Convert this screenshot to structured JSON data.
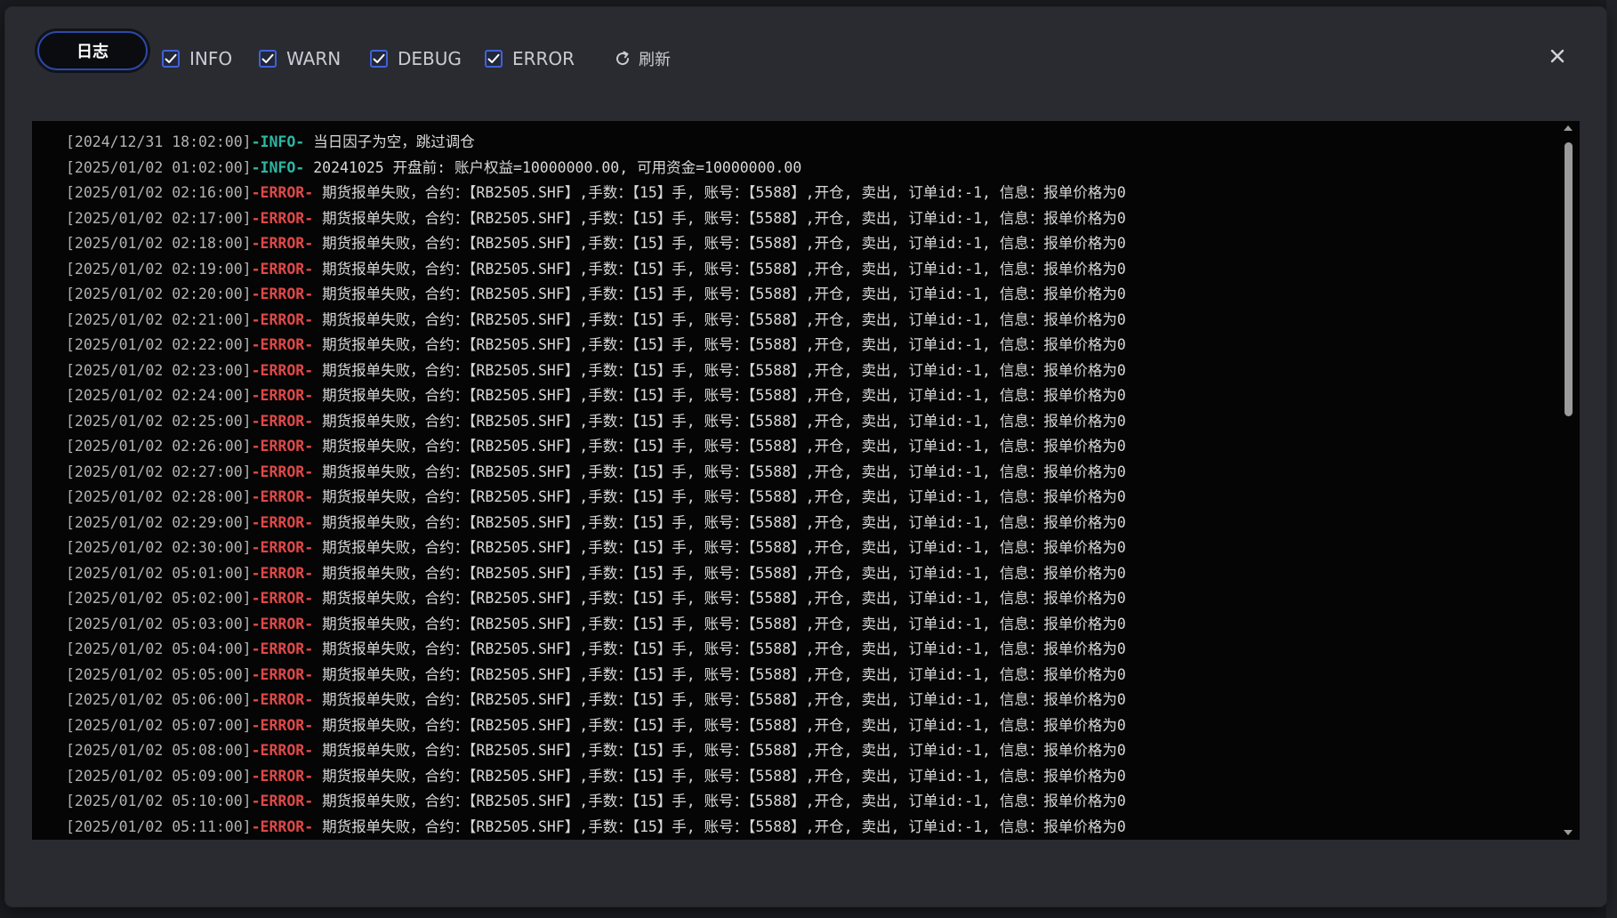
{
  "toolbar": {
    "log_tab_label": "日志",
    "filters": [
      {
        "label": "INFO",
        "checked": true
      },
      {
        "label": "WARN",
        "checked": true
      },
      {
        "label": "DEBUG",
        "checked": true
      },
      {
        "label": "ERROR",
        "checked": true
      }
    ],
    "refresh_label": "刷新",
    "close_icon": "close-icon"
  },
  "colors": {
    "accent": "#3f63d6",
    "info_level": "#2bb8a4",
    "error_level": "#e04848"
  },
  "logs": [
    {
      "ts": "[2024/12/31 18:02:00]",
      "level": "-INFO-",
      "msg": "当日因子为空，跳过调仓"
    },
    {
      "ts": "[2025/01/02 01:02:00]",
      "level": "-INFO-",
      "msg": "20241025 开盘前: 账户权益=10000000.00, 可用资金=10000000.00"
    },
    {
      "ts": "[2025/01/02 02:16:00]",
      "level": "-ERROR-",
      "msg": "期货报单失败，合约：【RB2505.SHF】,手数：【15】手, 账号：【5588】,开仓, 卖出, 订单id:-1, 信息：报单价格为0"
    },
    {
      "ts": "[2025/01/02 02:17:00]",
      "level": "-ERROR-",
      "msg": "期货报单失败，合约：【RB2505.SHF】,手数：【15】手, 账号：【5588】,开仓, 卖出, 订单id:-1, 信息：报单价格为0"
    },
    {
      "ts": "[2025/01/02 02:18:00]",
      "level": "-ERROR-",
      "msg": "期货报单失败，合约：【RB2505.SHF】,手数：【15】手, 账号：【5588】,开仓, 卖出, 订单id:-1, 信息：报单价格为0"
    },
    {
      "ts": "[2025/01/02 02:19:00]",
      "level": "-ERROR-",
      "msg": "期货报单失败，合约：【RB2505.SHF】,手数：【15】手, 账号：【5588】,开仓, 卖出, 订单id:-1, 信息：报单价格为0"
    },
    {
      "ts": "[2025/01/02 02:20:00]",
      "level": "-ERROR-",
      "msg": "期货报单失败，合约：【RB2505.SHF】,手数：【15】手, 账号：【5588】,开仓, 卖出, 订单id:-1, 信息：报单价格为0"
    },
    {
      "ts": "[2025/01/02 02:21:00]",
      "level": "-ERROR-",
      "msg": "期货报单失败，合约：【RB2505.SHF】,手数：【15】手, 账号：【5588】,开仓, 卖出, 订单id:-1, 信息：报单价格为0"
    },
    {
      "ts": "[2025/01/02 02:22:00]",
      "level": "-ERROR-",
      "msg": "期货报单失败，合约：【RB2505.SHF】,手数：【15】手, 账号：【5588】,开仓, 卖出, 订单id:-1, 信息：报单价格为0"
    },
    {
      "ts": "[2025/01/02 02:23:00]",
      "level": "-ERROR-",
      "msg": "期货报单失败，合约：【RB2505.SHF】,手数：【15】手, 账号：【5588】,开仓, 卖出, 订单id:-1, 信息：报单价格为0"
    },
    {
      "ts": "[2025/01/02 02:24:00]",
      "level": "-ERROR-",
      "msg": "期货报单失败，合约：【RB2505.SHF】,手数：【15】手, 账号：【5588】,开仓, 卖出, 订单id:-1, 信息：报单价格为0"
    },
    {
      "ts": "[2025/01/02 02:25:00]",
      "level": "-ERROR-",
      "msg": "期货报单失败，合约：【RB2505.SHF】,手数：【15】手, 账号：【5588】,开仓, 卖出, 订单id:-1, 信息：报单价格为0"
    },
    {
      "ts": "[2025/01/02 02:26:00]",
      "level": "-ERROR-",
      "msg": "期货报单失败，合约：【RB2505.SHF】,手数：【15】手, 账号：【5588】,开仓, 卖出, 订单id:-1, 信息：报单价格为0"
    },
    {
      "ts": "[2025/01/02 02:27:00]",
      "level": "-ERROR-",
      "msg": "期货报单失败，合约：【RB2505.SHF】,手数：【15】手, 账号：【5588】,开仓, 卖出, 订单id:-1, 信息：报单价格为0"
    },
    {
      "ts": "[2025/01/02 02:28:00]",
      "level": "-ERROR-",
      "msg": "期货报单失败，合约：【RB2505.SHF】,手数：【15】手, 账号：【5588】,开仓, 卖出, 订单id:-1, 信息：报单价格为0"
    },
    {
      "ts": "[2025/01/02 02:29:00]",
      "level": "-ERROR-",
      "msg": "期货报单失败，合约：【RB2505.SHF】,手数：【15】手, 账号：【5588】,开仓, 卖出, 订单id:-1, 信息：报单价格为0"
    },
    {
      "ts": "[2025/01/02 02:30:00]",
      "level": "-ERROR-",
      "msg": "期货报单失败，合约：【RB2505.SHF】,手数：【15】手, 账号：【5588】,开仓, 卖出, 订单id:-1, 信息：报单价格为0"
    },
    {
      "ts": "[2025/01/02 05:01:00]",
      "level": "-ERROR-",
      "msg": "期货报单失败，合约：【RB2505.SHF】,手数：【15】手, 账号：【5588】,开仓, 卖出, 订单id:-1, 信息：报单价格为0"
    },
    {
      "ts": "[2025/01/02 05:02:00]",
      "level": "-ERROR-",
      "msg": "期货报单失败，合约：【RB2505.SHF】,手数：【15】手, 账号：【5588】,开仓, 卖出, 订单id:-1, 信息：报单价格为0"
    },
    {
      "ts": "[2025/01/02 05:03:00]",
      "level": "-ERROR-",
      "msg": "期货报单失败，合约：【RB2505.SHF】,手数：【15】手, 账号：【5588】,开仓, 卖出, 订单id:-1, 信息：报单价格为0"
    },
    {
      "ts": "[2025/01/02 05:04:00]",
      "level": "-ERROR-",
      "msg": "期货报单失败，合约：【RB2505.SHF】,手数：【15】手, 账号：【5588】,开仓, 卖出, 订单id:-1, 信息：报单价格为0"
    },
    {
      "ts": "[2025/01/02 05:05:00]",
      "level": "-ERROR-",
      "msg": "期货报单失败，合约：【RB2505.SHF】,手数：【15】手, 账号：【5588】,开仓, 卖出, 订单id:-1, 信息：报单价格为0"
    },
    {
      "ts": "[2025/01/02 05:06:00]",
      "level": "-ERROR-",
      "msg": "期货报单失败，合约：【RB2505.SHF】,手数：【15】手, 账号：【5588】,开仓, 卖出, 订单id:-1, 信息：报单价格为0"
    },
    {
      "ts": "[2025/01/02 05:07:00]",
      "level": "-ERROR-",
      "msg": "期货报单失败，合约：【RB2505.SHF】,手数：【15】手, 账号：【5588】,开仓, 卖出, 订单id:-1, 信息：报单价格为0"
    },
    {
      "ts": "[2025/01/02 05:08:00]",
      "level": "-ERROR-",
      "msg": "期货报单失败，合约：【RB2505.SHF】,手数：【15】手, 账号：【5588】,开仓, 卖出, 订单id:-1, 信息：报单价格为0"
    },
    {
      "ts": "[2025/01/02 05:09:00]",
      "level": "-ERROR-",
      "msg": "期货报单失败，合约：【RB2505.SHF】,手数：【15】手, 账号：【5588】,开仓, 卖出, 订单id:-1, 信息：报单价格为0"
    },
    {
      "ts": "[2025/01/02 05:10:00]",
      "level": "-ERROR-",
      "msg": "期货报单失败，合约：【RB2505.SHF】,手数：【15】手, 账号：【5588】,开仓, 卖出, 订单id:-1, 信息：报单价格为0"
    },
    {
      "ts": "[2025/01/02 05:11:00]",
      "level": "-ERROR-",
      "msg": "期货报单失败，合约：【RB2505.SHF】,手数：【15】手, 账号：【5588】,开仓, 卖出, 订单id:-1, 信息：报单价格为0"
    }
  ]
}
